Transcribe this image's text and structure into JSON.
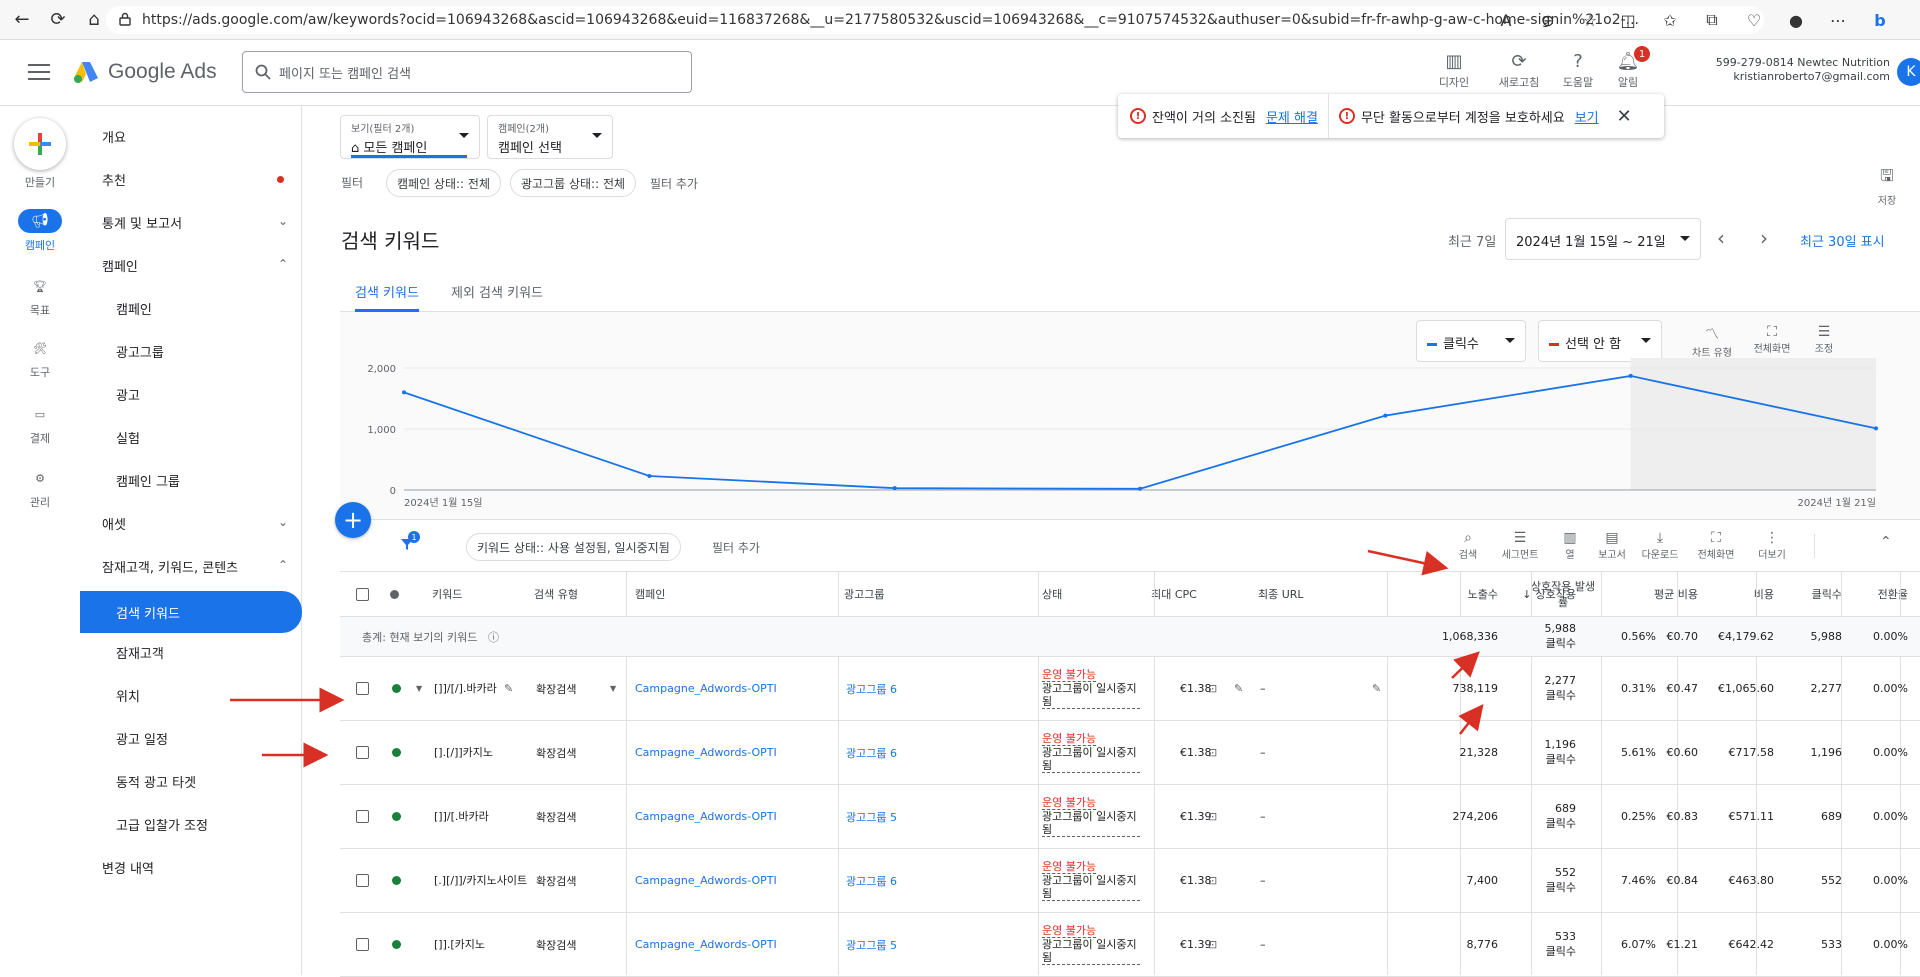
{
  "browser": {
    "url": "https://ads.google.com/aw/keywords?ocid=106943268&ascid=106943268&euid=116837268&__u=2177580532&uscid=106943268&__c=9107574532&authuser=0&subid=fr-fr-awhp-g-aw-c-home-signin%21o2-..."
  },
  "header": {
    "logo": "Google Ads",
    "search_placeholder": "페이지 또는 캠페인 검색",
    "tools": [
      "디자인",
      "새로고침",
      "도움말",
      "알림"
    ],
    "notif_count": "1",
    "account_line1": "599-279-0814 Newtec Nutrition",
    "account_line2": "kristianroberto7@gmail.com",
    "avatar": "K"
  },
  "rail": {
    "create": "만들기",
    "items": [
      "캠페인",
      "목표",
      "도구",
      "결제",
      "관리"
    ]
  },
  "sidenav": {
    "items": [
      "개요",
      "추천",
      "통계 및 보고서",
      "캠페인",
      "캠페인",
      "광고그룹",
      "광고",
      "실험",
      "캠페인 그룹",
      "애셋",
      "잠재고객, 키워드, 콘텐츠",
      "검색 키워드",
      "잠재고객",
      "위치",
      "광고 일정",
      "동적 광고 타겟",
      "고급 입찰가 조정",
      "변경 내역"
    ]
  },
  "filters": {
    "view_sub": "보기(필터 2개)",
    "view_val": "모든 캠페인",
    "camp_sub": "캠페인(2개)",
    "camp_val": "캠페인 선택",
    "label": "필터",
    "chip1": "캠페인 상태:: 전체",
    "chip2": "광고그룹 상태:: 전체",
    "add": "필터 추가",
    "save": "저장"
  },
  "notice": {
    "msg1": "잔액이 거의 소진됨",
    "link1": "문제 해결",
    "msg2": "무단 활동으로부터 계정을 보호하세요",
    "link2": "보기"
  },
  "page": {
    "title": "검색 키워드",
    "date_label": "최근 7일",
    "date_range": "2024년 1월 15일 ~ 21일",
    "show30": "최근 30일 표시",
    "tab1": "검색 키워드",
    "tab2": "제외 검색 키워드"
  },
  "chart_controls": {
    "metric1": "클릭수",
    "metric2": "선택 안 함",
    "tools": [
      "차트 유형",
      "전체화면",
      "조정"
    ]
  },
  "chart_data": {
    "type": "line",
    "x": [
      "2024년 1월 15일",
      "",
      "",
      "",
      "",
      "",
      "2024년 1월 21일"
    ],
    "series": [
      {
        "values": [
          1600,
          230,
          30,
          20,
          1220,
          1870,
          1010
        ]
      }
    ],
    "ylim": [
      0,
      2000
    ],
    "yticks": [
      "2,000",
      "1,000",
      "0"
    ],
    "xlabels": [
      "2024년 1월 15일",
      "2024년 1월 21일"
    ],
    "color": "#1a73e8"
  },
  "table_tools": {
    "filter_badge": "1",
    "chip": "키워드 상태:: 사용 설정됨, 일시중지됨",
    "add": "필터 추가",
    "buttons": [
      "검색",
      "세그먼트",
      "열",
      "보고서",
      "다운로드",
      "전체화면",
      "더보기"
    ]
  },
  "table": {
    "headers": [
      "키워드",
      "검색 유형",
      "캠페인",
      "광고그룹",
      "상태",
      "최대 CPC",
      "최종 URL",
      "노출수",
      "상호작용",
      "상호작용 발생률",
      "평균 비용",
      "비용",
      "클릭수",
      "전환율"
    ],
    "total": {
      "label": "총계: 현재 보기의 키워드",
      "impressions": "1,068,336",
      "interactions": "5,988",
      "interaction_unit": "클릭수",
      "rate": "0.56%",
      "avg_cost": "€0.70",
      "cost": "€4,179.62",
      "clicks": "5,988",
      "conv": "0.00%"
    },
    "rows": [
      {
        "keyword": "[]]/[/].바카라",
        "match": "확장검색",
        "campaign": "Campagne_Adwords-OPTI",
        "adgroup": "광고그룹 6",
        "status1": "운영 불가능",
        "status2": "광고그룹이 일시중지됨",
        "cpc": "€1.38",
        "url": "–",
        "impr": "738,119",
        "inter": "2,277",
        "unit": "클릭수",
        "rate": "0.31%",
        "avg": "€0.47",
        "cost": "€1,065.60",
        "clicks": "2,277",
        "conv": "0.00%"
      },
      {
        "keyword": "[].[/]]카지노",
        "match": "확장검색",
        "campaign": "Campagne_Adwords-OPTI",
        "adgroup": "광고그룹 6",
        "status1": "운영 불가능",
        "status2": "광고그룹이 일시중지됨",
        "cpc": "€1.38",
        "url": "–",
        "impr": "21,328",
        "inter": "1,196",
        "unit": "클릭수",
        "rate": "5.61%",
        "avg": "€0.60",
        "cost": "€717.58",
        "clicks": "1,196",
        "conv": "0.00%"
      },
      {
        "keyword": "[]]/[.바카라",
        "match": "확장검색",
        "campaign": "Campagne_Adwords-OPTI",
        "adgroup": "광고그룹 5",
        "status1": "운영 불가능",
        "status2": "광고그룹이 일시중지됨",
        "cpc": "€1.39",
        "url": "–",
        "impr": "274,206",
        "inter": "689",
        "unit": "클릭수",
        "rate": "0.25%",
        "avg": "€0.83",
        "cost": "€571.11",
        "clicks": "689",
        "conv": "0.00%"
      },
      {
        "keyword": "[.][/]]/카지노사이트",
        "match": "확장검색",
        "campaign": "Campagne_Adwords-OPTI",
        "adgroup": "광고그룹 6",
        "status1": "운영 불가능",
        "status2": "광고그룹이 일시중지됨",
        "cpc": "€1.38",
        "url": "–",
        "impr": "7,400",
        "inter": "552",
        "unit": "클릭수",
        "rate": "7.46%",
        "avg": "€0.84",
        "cost": "€463.80",
        "clicks": "552",
        "conv": "0.00%"
      },
      {
        "keyword": "[]].[카지노",
        "match": "확장검색",
        "campaign": "Campagne_Adwords-OPTI",
        "adgroup": "광고그룹 5",
        "status1": "운영 불가능",
        "status2": "광고그룹이 일시중지됨",
        "cpc": "€1.39",
        "url": "–",
        "impr": "8,776",
        "inter": "533",
        "unit": "클릭수",
        "rate": "6.07%",
        "avg": "€1.21",
        "cost": "€642.42",
        "clicks": "533",
        "conv": "0.00%"
      }
    ]
  }
}
